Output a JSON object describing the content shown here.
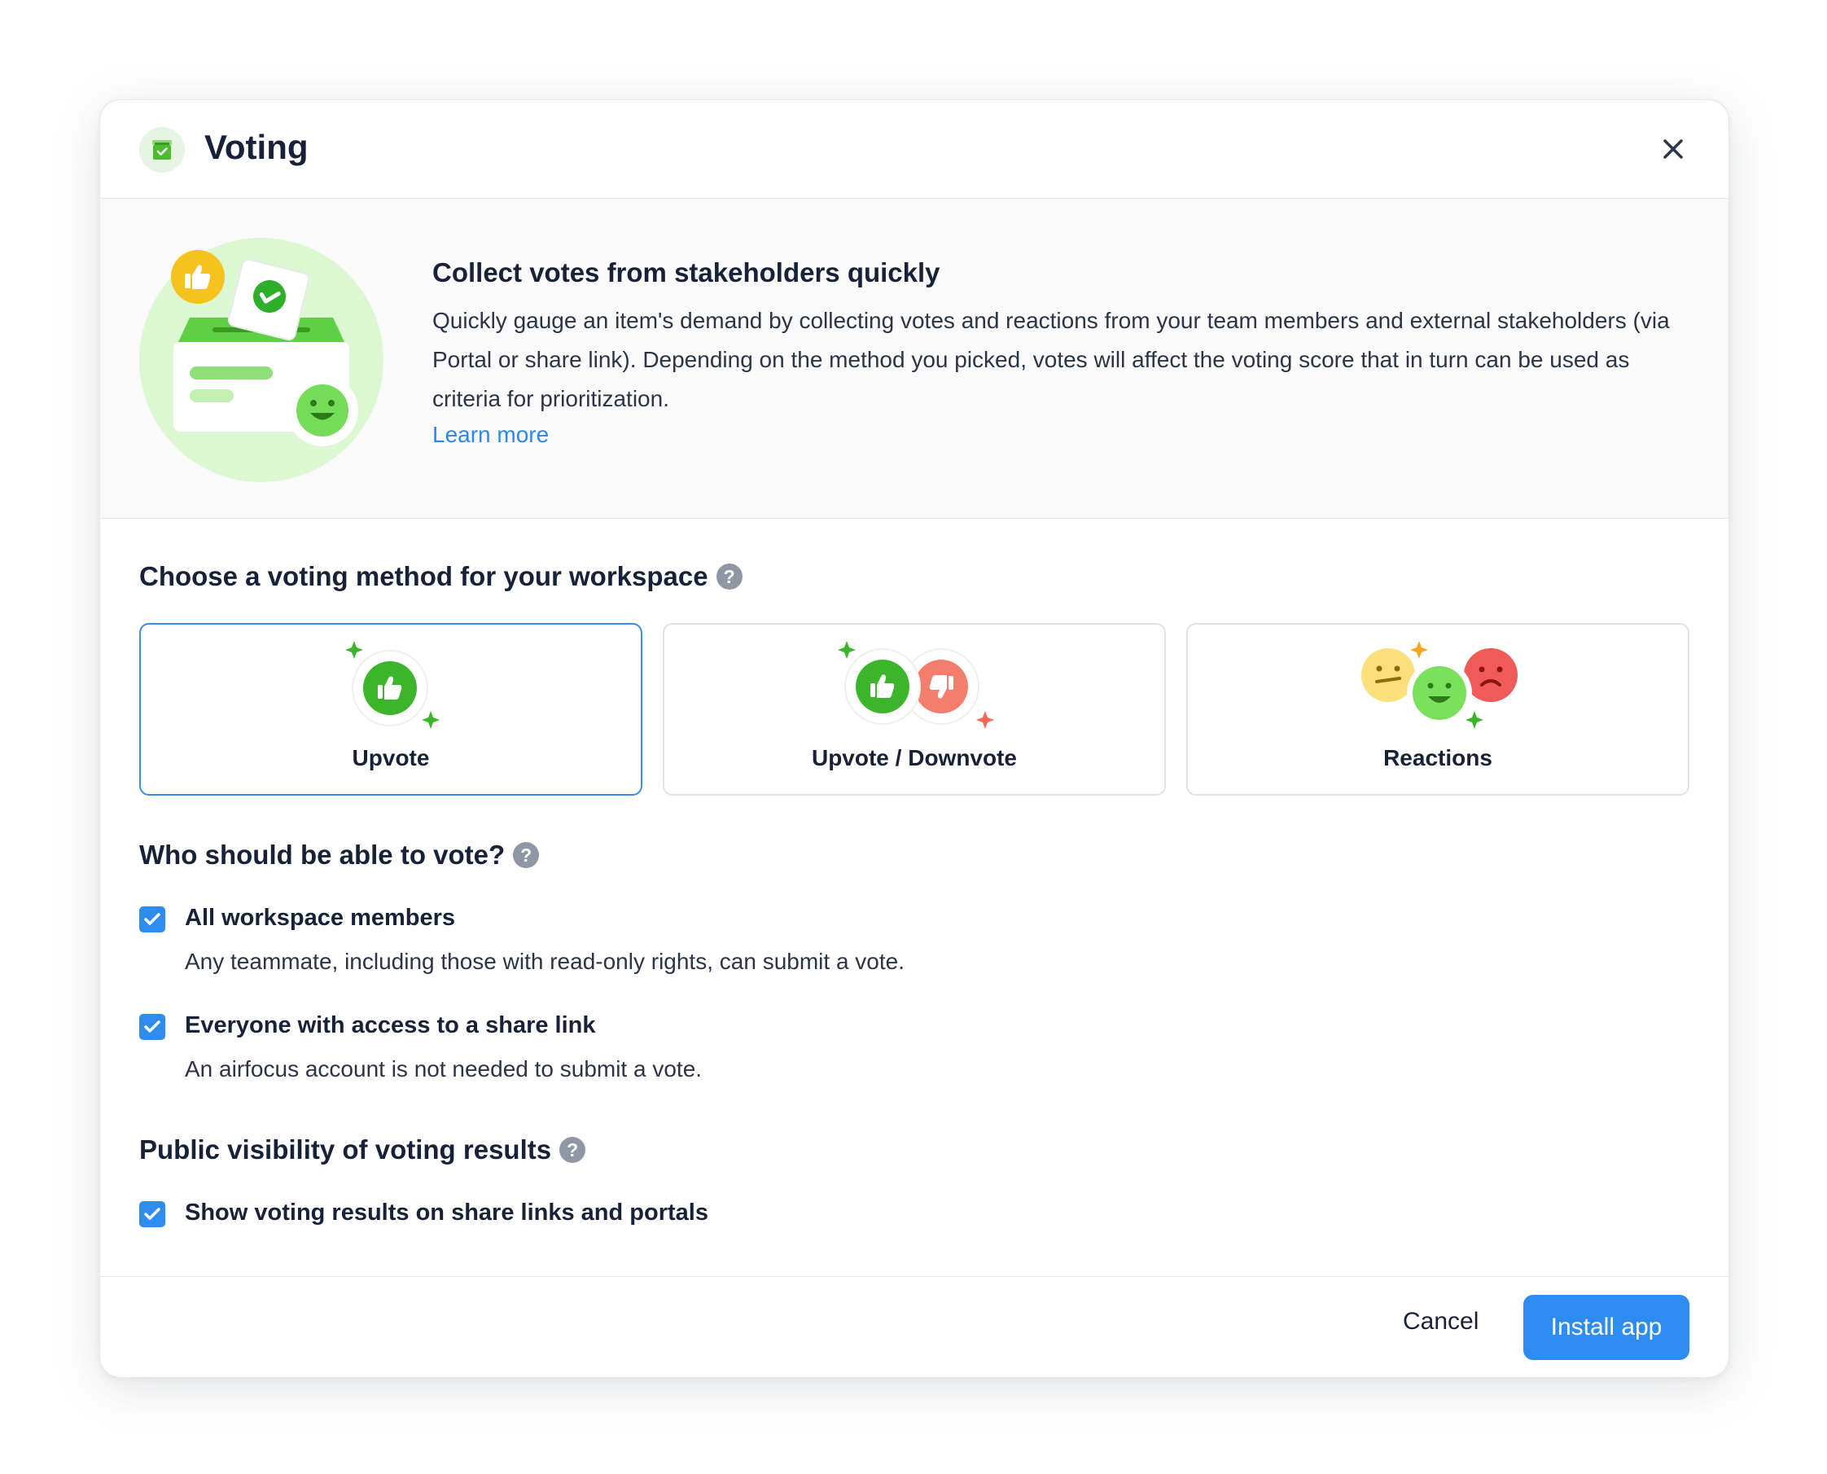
{
  "dialog": {
    "title": "Voting",
    "app_icon": "ballot-box-icon",
    "close_icon": "close-icon"
  },
  "intro": {
    "heading": "Collect votes from stakeholders quickly",
    "body": "Quickly gauge an item's demand by collecting votes and reactions from your team members and external stakeholders (via Portal or share link). Depending on the method you picked, votes will affect the voting score that in turn can be used as criteria for prioritization.",
    "learn_more": "Learn more",
    "illustration": "ballot-box-illustration"
  },
  "method": {
    "title": "Choose a voting method for your workspace",
    "help": "?",
    "options": [
      {
        "label": "Upvote",
        "icon": "thumbs-up-icon",
        "selected": true
      },
      {
        "label": "Upvote / Downvote",
        "icon": "thumbs-up-down-icon",
        "selected": false
      },
      {
        "label": "Reactions",
        "icon": "reactions-icon",
        "selected": false
      }
    ]
  },
  "voters": {
    "title": "Who should be able to vote?",
    "help": "?",
    "options": [
      {
        "label": "All workspace members",
        "description": "Any teammate, including those with read-only rights, can submit a vote.",
        "checked": true
      },
      {
        "label": "Everyone with access to a share link",
        "description": "An airfocus account is not needed to submit a vote.",
        "checked": true
      }
    ]
  },
  "visibility": {
    "title": "Public visibility of voting results",
    "help": "?",
    "options": [
      {
        "label": "Show voting results on share links and portals",
        "checked": true
      }
    ]
  },
  "footer": {
    "cancel": "Cancel",
    "install": "Install app"
  },
  "colors": {
    "accent": "#2d8cf0",
    "selected_border": "#3a8ee6",
    "green": "#4cbb2f",
    "red": "#f07060"
  }
}
